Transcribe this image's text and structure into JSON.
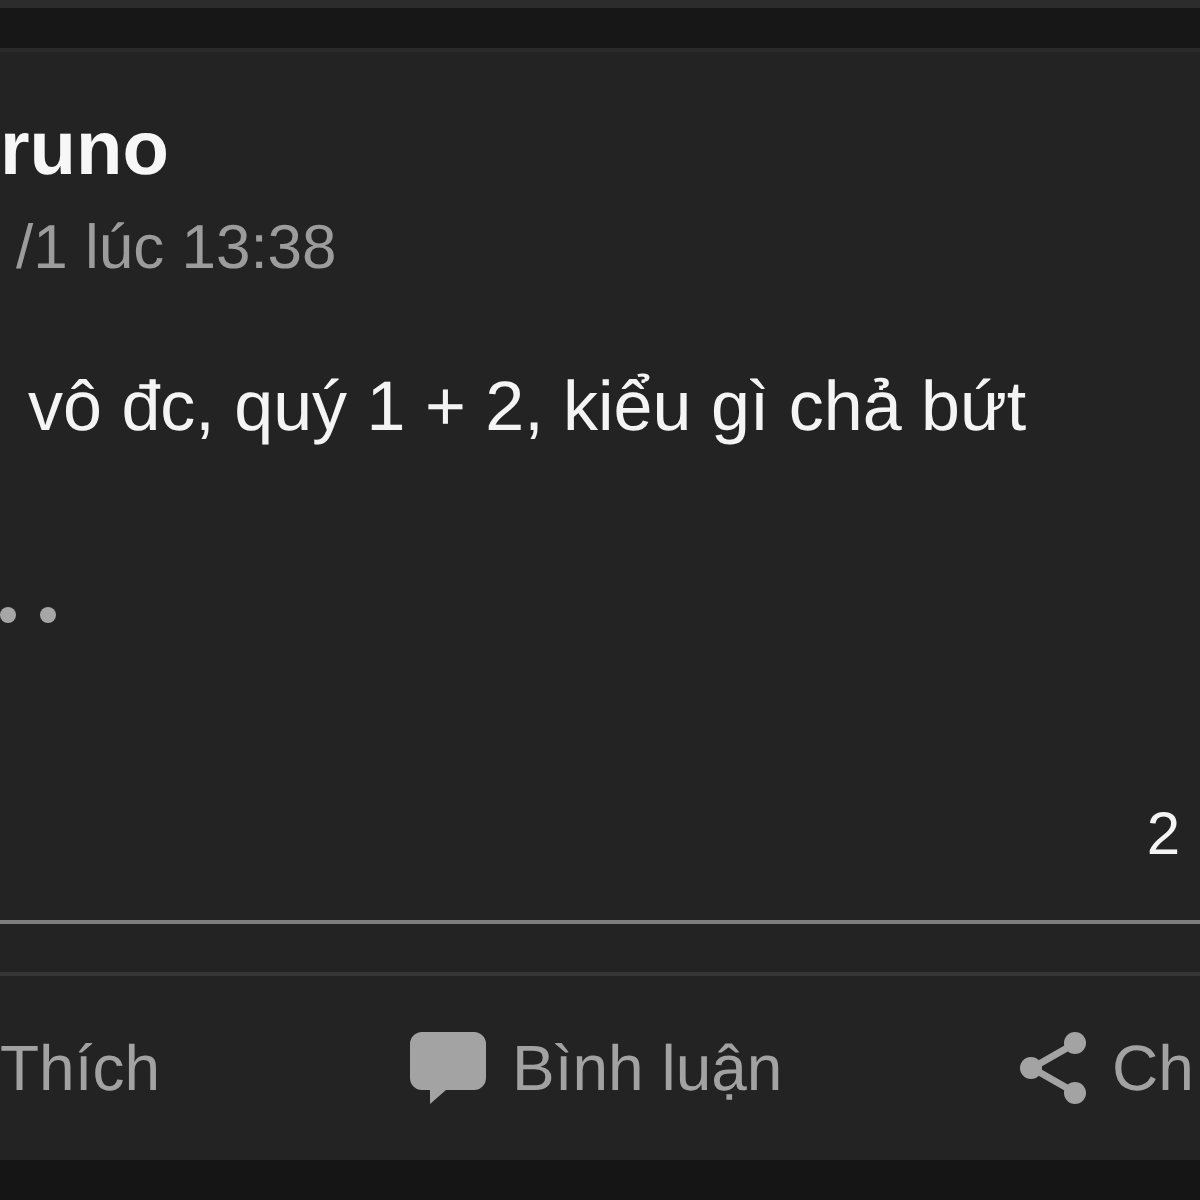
{
  "post": {
    "author": "runo",
    "time": "/1 lúc 13:38",
    "text": "vô đc, quý 1 + 2, kiểu gì chả bứt",
    "count": "2"
  },
  "actions": [
    {
      "kind": "like",
      "label": "Thích"
    },
    {
      "kind": "comment",
      "label": "Bình luận"
    },
    {
      "kind": "share",
      "label": "Ch"
    }
  ]
}
